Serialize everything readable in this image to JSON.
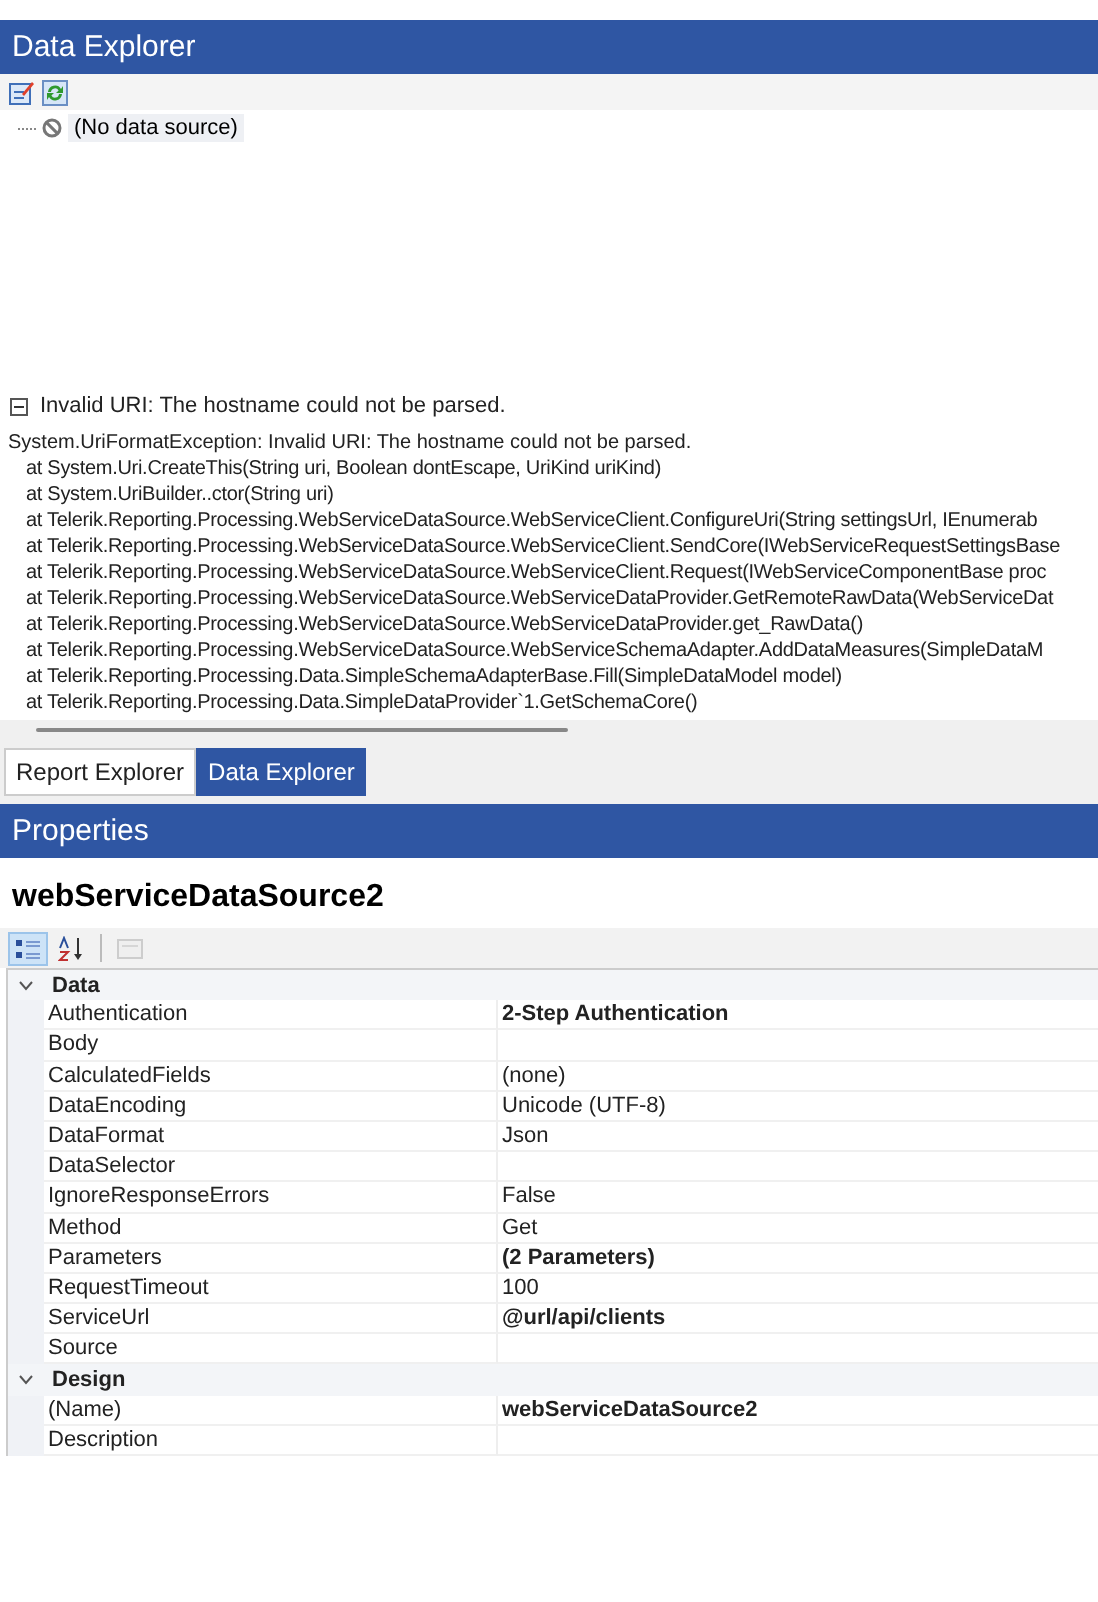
{
  "data_explorer": {
    "title": "Data Explorer",
    "toolbar": [
      {
        "kind": "edit"
      },
      {
        "kind": "refresh"
      }
    ],
    "tree": [
      {
        "label": "(No data source)",
        "selected": true
      }
    ]
  },
  "error": {
    "title": "Invalid URI: The hostname could not be parsed.",
    "expanded": true,
    "message": "System.UriFormatException: Invalid URI: The hostname could not be parsed.",
    "stack": [
      "at System.Uri.CreateThis(String uri, Boolean dontEscape, UriKind uriKind)",
      "at System.UriBuilder..ctor(String uri)",
      "at Telerik.Reporting.Processing.WebServiceDataSource.WebServiceClient.ConfigureUri(String settingsUrl, IEnumerab",
      "at Telerik.Reporting.Processing.WebServiceDataSource.WebServiceClient.SendCore(IWebServiceRequestSettingsBase",
      "at Telerik.Reporting.Processing.WebServiceDataSource.WebServiceClient.Request(IWebServiceComponentBase proc",
      "at Telerik.Reporting.Processing.WebServiceDataSource.WebServiceDataProvider.GetRemoteRawData(WebServiceDat",
      "at Telerik.Reporting.Processing.WebServiceDataSource.WebServiceDataProvider.get_RawData()",
      "at Telerik.Reporting.Processing.WebServiceDataSource.WebServiceSchemaAdapter.AddDataMeasures(SimpleDataM",
      "at Telerik.Reporting.Processing.Data.SimpleSchemaAdapterBase.Fill(SimpleDataModel model)",
      "at Telerik.Reporting.Processing.Data.SimpleDataProvider`1.GetSchemaCore()"
    ]
  },
  "tabs": [
    {
      "label": "Report Explorer",
      "selected": false
    },
    {
      "label": "Data Explorer",
      "selected": true
    }
  ],
  "properties": {
    "title": "Properties",
    "object_name": "webServiceDataSource2",
    "toolbar": [
      {
        "kind": "categorized",
        "selected": true,
        "disabled": false
      },
      {
        "kind": "alphabetical",
        "selected": false,
        "disabled": false
      },
      {
        "kind": "property-pages",
        "selected": false,
        "disabled": true
      }
    ],
    "groups": [
      {
        "name": "Data",
        "expanded": true,
        "rows": [
          {
            "name": "Authentication",
            "value": "2-Step Authentication",
            "bold": true
          },
          {
            "name": "Body"
          },
          {
            "name": "CalculatedFields",
            "value": "(none)",
            "bold": false
          },
          {
            "name": "DataEncoding",
            "value": "Unicode (UTF-8)",
            "bold": false
          },
          {
            "name": "DataFormat",
            "value": "Json",
            "bold": false
          },
          {
            "name": "DataSelector"
          },
          {
            "name": "IgnoreResponseErrors",
            "value": "False",
            "bold": false
          },
          {
            "name": "Method",
            "value": "Get",
            "bold": false
          },
          {
            "name": "Parameters",
            "value": "(2 Parameters)",
            "bold": true
          },
          {
            "name": "RequestTimeout",
            "value": "100",
            "bold": false
          },
          {
            "name": "ServiceUrl",
            "value": "@url/api/clients",
            "bold": true
          },
          {
            "name": "Source"
          }
        ]
      },
      {
        "name": "Design",
        "expanded": true,
        "rows": [
          {
            "name": "(Name)",
            "value": "webServiceDataSource2",
            "bold": true
          },
          {
            "name": "Description"
          }
        ]
      }
    ]
  }
}
